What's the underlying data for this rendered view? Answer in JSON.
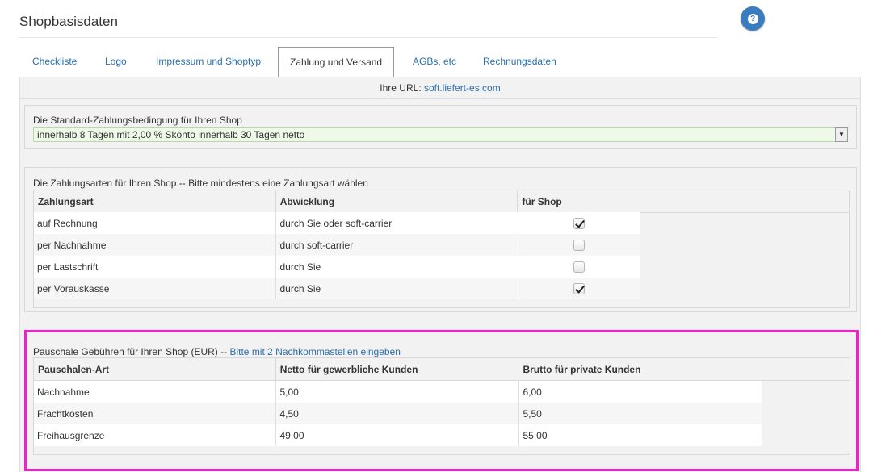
{
  "header": {
    "title": "Shopbasisdaten",
    "help_icon": "?"
  },
  "tabs": [
    {
      "label": "Checkliste"
    },
    {
      "label": "Logo"
    },
    {
      "label": "Impressum und Shoptyp"
    },
    {
      "label": "Zahlung und Versand",
      "active": true
    },
    {
      "label": "AGBs, etc"
    },
    {
      "label": "Rechnungsdaten"
    }
  ],
  "url": {
    "label": "Ihre URL:",
    "value": "soft.liefert-es.com"
  },
  "payment_condition": {
    "label": "Die Standard-Zahlungsbedingung für Ihren Shop",
    "selected": "innerhalb 8 Tagen mit 2,00 % Skonto innerhalb 30 Tagen netto"
  },
  "payment_methods": {
    "label": "Die Zahlungsarten für Ihren Shop -- Bitte mindestens eine Zahlungsart wählen",
    "columns": [
      "Zahlungsart",
      "Abwicklung",
      "für Shop"
    ],
    "rows": [
      {
        "method": "auf Rechnung",
        "handling": "durch Sie oder soft-carrier",
        "checked": true
      },
      {
        "method": "per Nachnahme",
        "handling": "durch soft-carrier",
        "checked": false
      },
      {
        "method": "per Lastschrift",
        "handling": "durch Sie",
        "checked": false
      },
      {
        "method": "per Vorauskasse",
        "handling": "durch Sie",
        "checked": true
      }
    ]
  },
  "fees": {
    "label": "Pauschale Gebühren für Ihren Shop (EUR) --",
    "hint": "Bitte mit 2 Nachkommastellen eingeben",
    "columns": [
      "Pauschalen-Art",
      "Netto für gewerbliche Kunden",
      "Brutto für private Kunden"
    ],
    "rows": [
      {
        "type": "Nachnahme",
        "net": "5,00",
        "gross": "6,00"
      },
      {
        "type": "Frachtkosten",
        "net": "4,50",
        "gross": "5,50"
      },
      {
        "type": "Freihausgrenze",
        "net": "49,00",
        "gross": "55,00"
      }
    ]
  },
  "colors": {
    "accent": "#2a6fad",
    "highlight": "#ee22cc",
    "help_button": "#3a7cc0"
  }
}
